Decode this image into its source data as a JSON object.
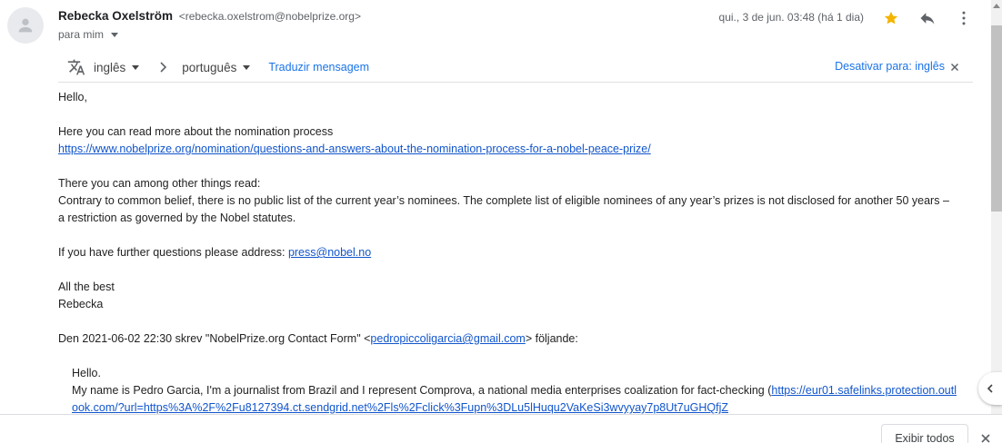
{
  "header": {
    "sender_name": "Rebecka Oxelström",
    "sender_email": "<rebecka.oxelstrom@nobelprize.org>",
    "recipient": "para mim",
    "date": "qui., 3 de jun. 03:48 (há 1 dia)",
    "icons": [
      "person-icon",
      "star-icon",
      "reply-icon",
      "more-vert-icon"
    ],
    "star_color": "#f4b400"
  },
  "translate": {
    "from_lang": "inglês",
    "to_lang": "português",
    "translate_label": "Traduzir mensagem",
    "disable_label": "Desativar para: inglês",
    "icon": "translate-icon"
  },
  "body": {
    "greeting": "Hello,",
    "intro": "Here you can read more about the nomination process",
    "nomination_link": "https://www.nobelprize.org/nomination/questions-and-answers-about-the-nomination-process-for-a-nobel-peace-prize/",
    "among": "There you can among other things read:",
    "quote": "Contrary to common belief, there is no public list of the current year’s nominees. The complete list of eligible nominees of any year’s prizes is not disclosed for another 50 years – a restriction as governed by the Nobel statutes.",
    "further_prefix": "If you have further questions please address: ",
    "press_email": "press@nobel.no",
    "closing": "All the best",
    "signature": "Rebecka",
    "quoted_header_prefix": "Den 2021-06-02 22:30 skrev \"NobelPrize.org Contact Form\" <",
    "quoted_header_email": "pedropiccoligarcia@gmail.com",
    "quoted_header_suffix": "> följande:",
    "quoted_hello": "Hello.",
    "quoted_text_prefix": "My name is Pedro Garcia, I'm a journalist from Brazil and I represent Comprova, a national media enterprises coalization for fact-checking (",
    "quoted_link": "https://eur01.safelinks.protection.outlook.com/?url=https%3A%2F%2Fu8127394.ct.sendgrid.net%2Fls%2Fclick%3Fupn%3DLu5lHuqu2VaKeSi3wvyyay7p8Ut7uGHQfjZ"
  },
  "footer": {
    "show_all_label": "Exibir todos"
  },
  "colors": {
    "link": "#1155cc",
    "accent_link": "#1a73e8"
  }
}
